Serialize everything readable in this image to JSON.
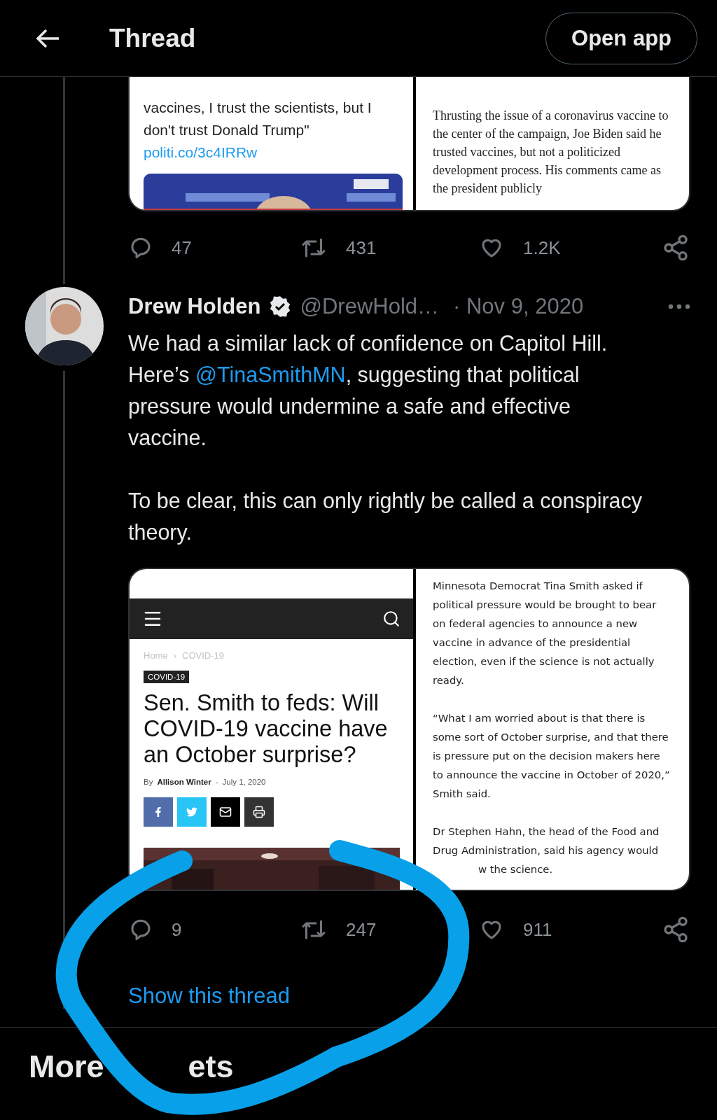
{
  "header": {
    "title": "Thread",
    "button": "Open app"
  },
  "previous_tweet": {
    "media": {
      "left": {
        "text": "vaccines, I trust the scientists, but I don't trust Donald Trump\"",
        "link": "politi.co/3c4IRRw"
      },
      "right": {
        "text": "Thrusting the issue of a coronavirus vaccine to the center of the campaign, Joe Biden said he trusted vaccines, but not a politicized development process. His comments came as the president publicly"
      }
    },
    "actions": [
      {
        "kind": "reply",
        "count": "47"
      },
      {
        "kind": "retweet",
        "count": "431"
      },
      {
        "kind": "like",
        "count": "1.2K"
      },
      {
        "kind": "share"
      }
    ]
  },
  "tweet": {
    "author": {
      "name": "Drew Holden",
      "verified": true,
      "handle": "@DrewHold…",
      "date": "· Nov 9, 2020"
    },
    "paragraphs": [
      [
        {
          "kind": "text",
          "text": "We had a similar lack of confidence on Capitol Hill. Here’s "
        },
        {
          "kind": "mention",
          "text": "@TinaSmithMN"
        },
        {
          "kind": "text",
          "text": ", suggesting that political pressure would undermine a safe and effective vaccine."
        }
      ],
      [
        {
          "kind": "text",
          "text": "To be clear, this can only rightly be called a conspiracy theory."
        }
      ]
    ],
    "media": {
      "article": {
        "breadcrumb": [
          "Home",
          "›",
          "COVID-19"
        ],
        "tag": "COVID-19",
        "headline": "Sen. Smith to feds: Will COVID-19 vaccine have an October surprise?",
        "byline": {
          "by": "By",
          "author": "Allison Winter",
          "separator": "-",
          "date": "July 1, 2020"
        },
        "share_buttons": [
          {
            "kind": "facebook"
          },
          {
            "kind": "twitter"
          },
          {
            "kind": "mail"
          },
          {
            "kind": "print"
          }
        ]
      },
      "text": [
        "Minnesota Democrat Tina Smith asked if political pressure would be brought to bear on federal agencies to announce a new vaccine in advance of the presidential election, even if the science is not actually ready.",
        "“What I am worried about is that there is some sort of October surprise, and that there is pressure put on the decision makers here to announce the vaccine in October of 2020,” Smith said.",
        "Dr Stephen Hahn, the head of the Food and Drug Administration, said his agency would"
      ],
      "text_tail": "w the science."
    },
    "actions": [
      {
        "kind": "reply",
        "count": "9"
      },
      {
        "kind": "retweet",
        "count": "247"
      },
      {
        "kind": "like",
        "count": "911"
      },
      {
        "kind": "share"
      }
    ],
    "show_thread": "Show this thread"
  },
  "section_heading": {
    "start": "More",
    "end": "ets"
  }
}
